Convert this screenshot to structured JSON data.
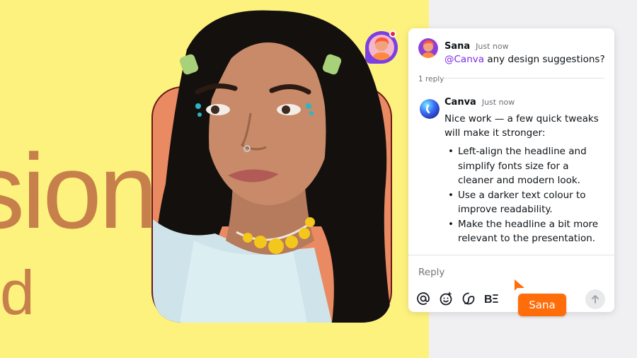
{
  "canvas": {
    "big_word": "sion",
    "big_letter": "d",
    "background_color": "#fdf27e",
    "text_color": "#c7804c"
  },
  "comment": {
    "author": "Sana",
    "time": "Just now",
    "mention": "@Canva",
    "text": " any design suggestions?"
  },
  "replies_label": "1 reply",
  "reply": {
    "author": "Canva",
    "time": "Just now",
    "intro": "Nice work — a few quick tweaks will make it stronger:",
    "bullets": [
      "Left-align the headline and simplify fonts size for a cleaner and modern look.",
      "Use a darker text colour to improve readability.",
      "Make the headline a bit more relevant to the presentation."
    ]
  },
  "reply_box": {
    "placeholder": "Reply"
  },
  "cursor": {
    "label": "Sana",
    "color": "#ff6d0a"
  },
  "icons": [
    "mention-icon",
    "emoji-icon",
    "sticker-icon",
    "brand-text-icon",
    "send-arrow-icon"
  ]
}
